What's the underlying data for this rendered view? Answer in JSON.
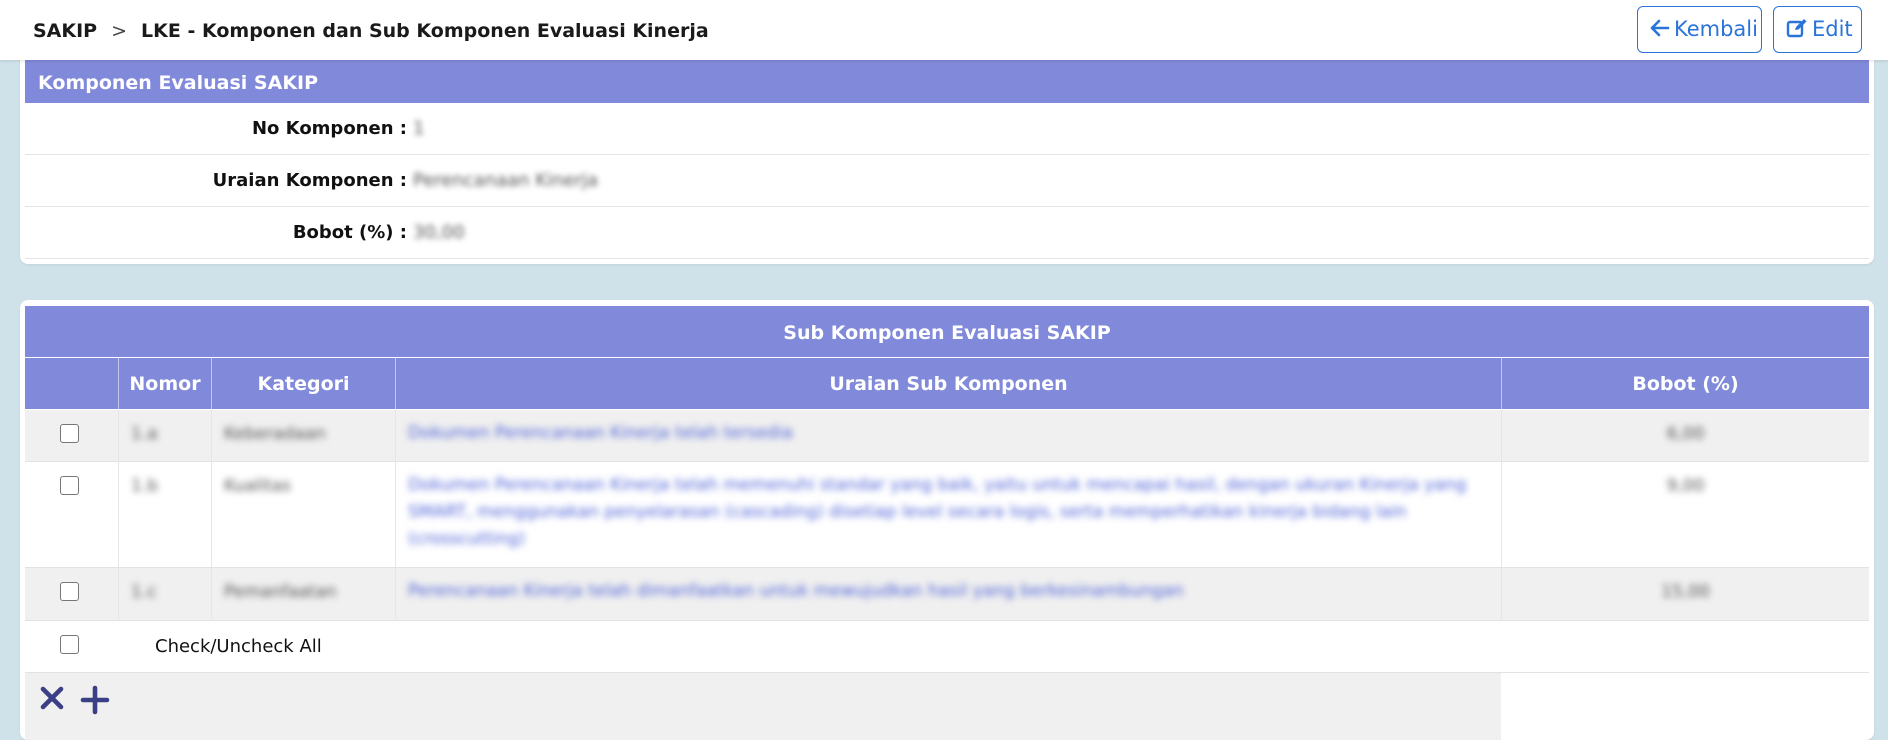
{
  "breadcrumb": {
    "root": "SAKIP",
    "separator": ">",
    "current": "LKE - Komponen dan Sub Komponen Evaluasi Kinerja"
  },
  "buttons": {
    "back": "Kembali",
    "edit": "Edit"
  },
  "component_card": {
    "title": "Komponen Evaluasi SAKIP",
    "fields": [
      {
        "label": "No Komponen :",
        "value": "1"
      },
      {
        "label": "Uraian Komponen :",
        "value": "Perencanaan Kinerja"
      },
      {
        "label": "Bobot (%) :",
        "value": "30,00"
      }
    ]
  },
  "sub_table": {
    "title": "Sub Komponen Evaluasi SAKIP",
    "columns": [
      "",
      "Nomor",
      "Kategori",
      "Uraian Sub Komponen",
      "Bobot (%)"
    ],
    "rows": [
      {
        "nomor": "1.a",
        "kategori": "Keberadaan",
        "uraian": "Dokumen Perencanaan Kinerja telah tersedia",
        "bobot": "6,00"
      },
      {
        "nomor": "1.b",
        "kategori": "Kualitas",
        "uraian": "Dokumen Perencanaan Kinerja telah memenuhi standar yang baik, yaitu untuk mencapai hasil, dengan ukuran Kinerja yang SMART, menggunakan penyelarasan (cascading) disetiap level secara logis, serta memperhatikan kinerja bidang lain (crosscutting)",
        "bobot": "9,00"
      },
      {
        "nomor": "1.c",
        "kategori": "Pemanfaatan",
        "uraian": "Perencanaan Kinerja telah dimanfaatkan untuk mewujudkan hasil yang berkesinambungan",
        "bobot": "15,00"
      }
    ],
    "check_all_label": "Check/Uncheck All"
  },
  "icons": {
    "back": "arrow-left-icon",
    "edit": "edit-icon",
    "delete": "close-icon",
    "add": "plus-icon"
  },
  "colors": {
    "header_bg": "#8189da",
    "accent": "#2a73d9",
    "page_bg": "#cfe2ea",
    "action_icon": "#3b3f86"
  }
}
